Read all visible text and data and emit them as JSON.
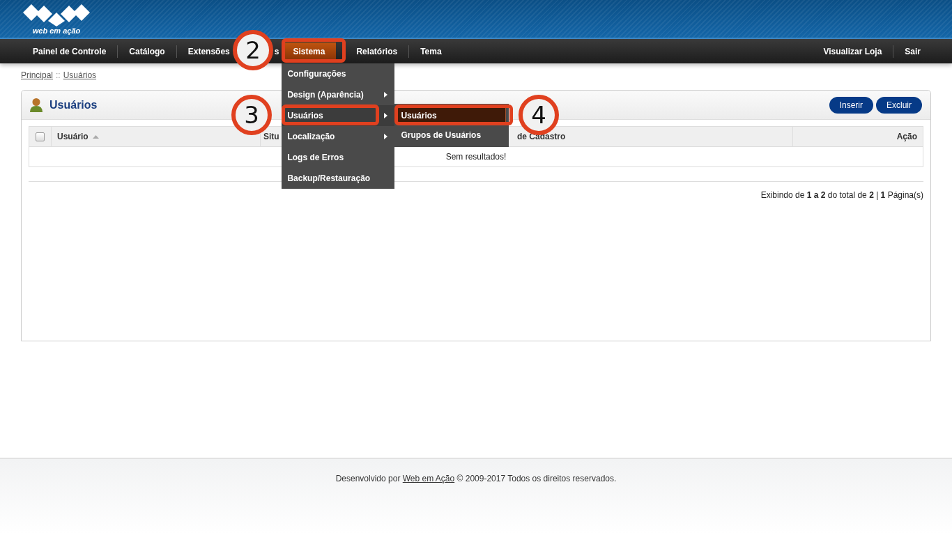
{
  "header": {
    "logo_text": "web em ação"
  },
  "nav": {
    "items": [
      {
        "label": "Painel de Controle",
        "selected": false
      },
      {
        "label": "Catálogo",
        "selected": false
      },
      {
        "label": "Extensões",
        "selected": false
      },
      {
        "label": "s",
        "selected": false
      },
      {
        "label": "Sistema",
        "selected": true
      },
      {
        "label": "Relatórios",
        "selected": false
      },
      {
        "label": "Tema",
        "selected": false
      }
    ],
    "right_items": [
      "Visualizar Loja",
      "Sair"
    ]
  },
  "dropdown": {
    "items": [
      {
        "label": "Configurações",
        "has_submenu": false,
        "selected": false
      },
      {
        "label": "Design (Aparência)",
        "has_submenu": true,
        "selected": false
      },
      {
        "label": "Usuários",
        "has_submenu": true,
        "selected": true
      },
      {
        "label": "Localização",
        "has_submenu": true,
        "selected": false
      },
      {
        "label": "Logs de Erros",
        "has_submenu": false,
        "selected": false
      },
      {
        "label": "Backup/Restauração",
        "has_submenu": false,
        "selected": false
      }
    ]
  },
  "submenu": {
    "items": [
      {
        "label": "Usuários",
        "selected": true
      },
      {
        "label": "Grupos de Usuários",
        "selected": false
      }
    ]
  },
  "breadcrumb": {
    "items": [
      "Principal",
      "Usuários"
    ],
    "separator": "::"
  },
  "panel": {
    "title": "Usuários",
    "buttons": [
      "Inserir",
      "Excluir"
    ]
  },
  "table": {
    "select_all_checked": false,
    "columns": [
      {
        "label": "Usuário",
        "sorted": true
      },
      {
        "label": "Situ",
        "sorted": false
      },
      {
        "label": "de Cadastro",
        "sorted": false
      },
      {
        "label": "Ação",
        "sorted": false
      }
    ],
    "empty_message": "Sem resultados!"
  },
  "pagination": "Exibindo de **1 a 2** do total de **2** | **1** Página(s)",
  "footer": {
    "prefix": "Desenvolvido por",
    "link": "Web em Ação",
    "suffix": "© 2009-2017 Todos os direitos reservados."
  },
  "annotations": [
    {
      "label": "2"
    },
    {
      "label": "3"
    },
    {
      "label": "4"
    }
  ]
}
